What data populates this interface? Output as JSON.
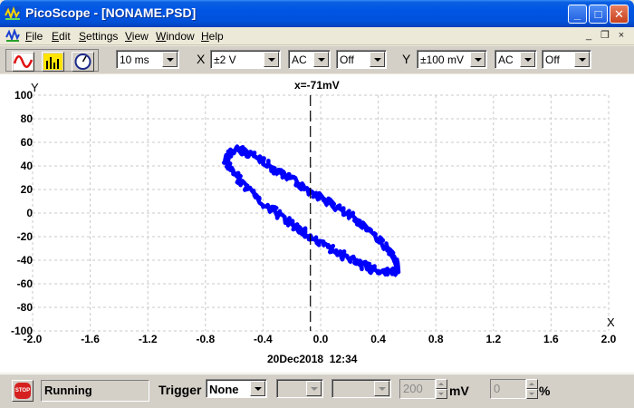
{
  "window": {
    "title": "PicoScope - [NONAME.PSD]",
    "minimize_symbol": "_",
    "maximize_symbol": "□",
    "close_symbol": "✕"
  },
  "menu": {
    "items": [
      "File",
      "Edit",
      "Settings",
      "View",
      "Window",
      "Help"
    ],
    "mdi_minimize": "_",
    "mdi_restore": "❐",
    "mdi_close": "×"
  },
  "toolbar": {
    "timebase": "10 ms",
    "x_label": "X",
    "x_range": "±2 V",
    "x_coupling": "AC",
    "x_option": "Off",
    "y_label": "Y",
    "y_range": "±100 mV",
    "y_coupling": "AC",
    "y_option": "Off",
    "icons": [
      "scope-view-icon",
      "spectrum-view-icon",
      "meter-view-icon"
    ]
  },
  "plot": {
    "cursor_readout": "x=-71mV",
    "timestamp": "20Dec2018  12:34",
    "trace_color": "#0000ff",
    "chart_data": {
      "type": "scatter",
      "title": "",
      "xlabel": "X",
      "ylabel": "Y",
      "xlim": [
        -2.0,
        2.0
      ],
      "ylim": [
        -100,
        100
      ],
      "x_ticks": [
        "-2.0",
        "-1.6",
        "-1.2",
        "-0.8",
        "-0.4",
        "0.0",
        "0.4",
        "0.8",
        "1.2",
        "1.6",
        "2.0"
      ],
      "y_ticks": [
        "100",
        "80",
        "60",
        "40",
        "20",
        "0",
        "-20",
        "-40",
        "-60",
        "-80",
        "-100"
      ],
      "grid": true,
      "cursor_x": -0.071,
      "series": [
        {
          "x": [
            -0.62,
            -0.55,
            -0.45,
            -0.35,
            -0.25,
            -0.15,
            -0.05,
            0.05,
            0.15,
            0.25,
            0.35,
            0.45,
            0.52,
            0.54,
            0.52,
            0.45,
            0.35,
            0.25,
            0.15,
            0.05,
            -0.05,
            -0.15,
            -0.25,
            -0.35,
            -0.45,
            -0.55,
            -0.62,
            -0.66,
            -0.62
          ],
          "y": [
            52,
            54,
            48,
            40,
            32,
            25,
            17,
            10,
            2,
            -6,
            -15,
            -28,
            -40,
            -47,
            -50,
            -50,
            -47,
            -42,
            -36,
            -29,
            -22,
            -14,
            -5,
            4,
            14,
            26,
            37,
            46,
            52
          ]
        }
      ]
    }
  },
  "statusbar": {
    "stop_label": "STOP",
    "status": "Running",
    "trigger_label": "Trigger",
    "trigger_mode": "None",
    "trigger_channel": "",
    "trigger_direction": "",
    "trigger_level": "200",
    "trigger_level_unit": "mV",
    "pretrigger": "0",
    "pretrigger_unit": "%"
  }
}
